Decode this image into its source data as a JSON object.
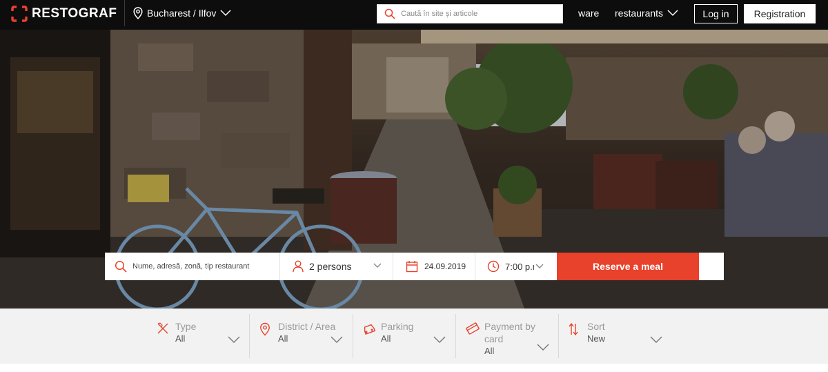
{
  "header": {
    "logo_text": "RESTOGRAF",
    "city_label": "Bucharest / Ilfov",
    "search_placeholder": "Caută în site și articole",
    "nav_ware": "ware",
    "nav_restaurants": "restaurants",
    "login_label": "Log in",
    "registration_label": "Registration"
  },
  "reservation": {
    "search_placeholder": "Nume, adresă, zonă, tip restaurant",
    "persons": "2 persons",
    "date": "24.09.2019",
    "time": "7:00 p.m.",
    "reserve_label": "Reserve a meal"
  },
  "filters": [
    {
      "label": "Type",
      "value": "All",
      "icon": "cutlery-icon"
    },
    {
      "label": "District / Area",
      "value": "All",
      "icon": "location-pin-icon"
    },
    {
      "label": "Parking",
      "value": "All",
      "icon": "car-icon"
    },
    {
      "label": "Payment by card",
      "value": "All",
      "icon": "credit-card-icon"
    },
    {
      "label": "Sort",
      "value": "New",
      "icon": "sort-arrows-icon"
    }
  ],
  "colors": {
    "accent": "#e8412c",
    "header_bg": "#0d0d0d",
    "filter_bg": "#f2f2f2"
  }
}
